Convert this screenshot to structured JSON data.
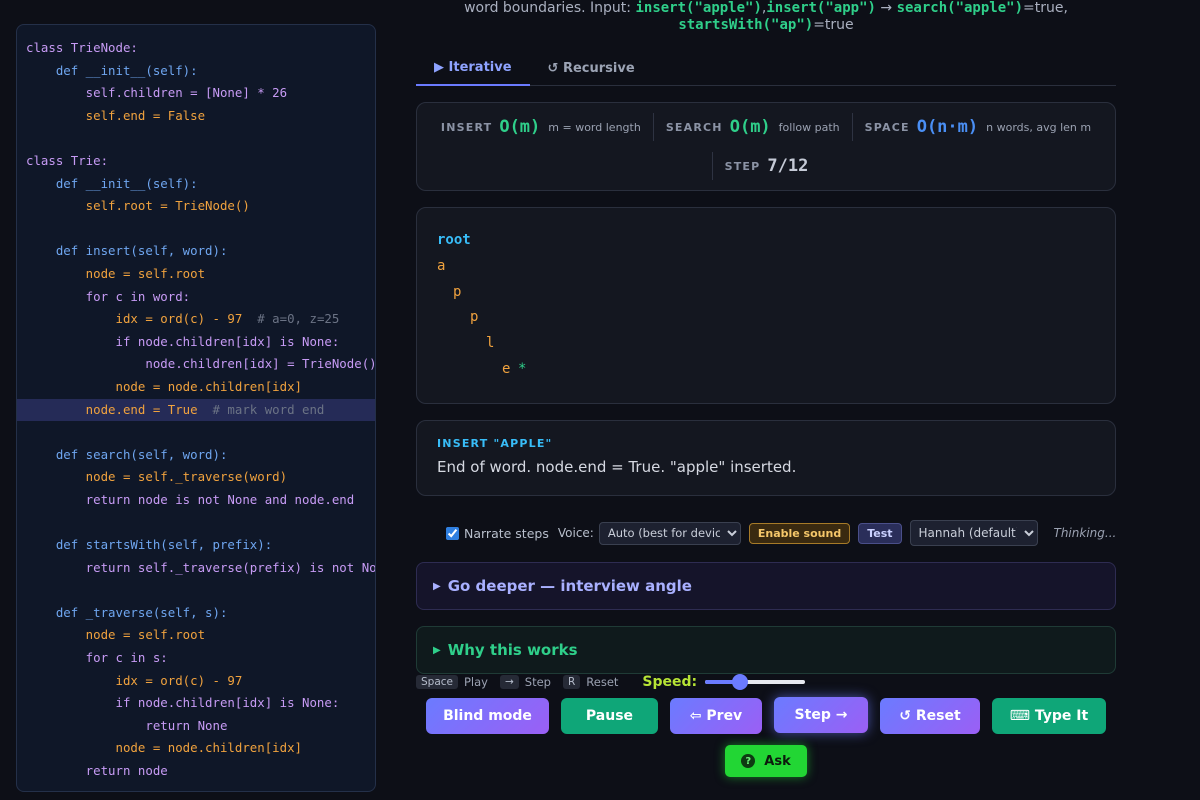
{
  "colors": {
    "accent": "#6b7bff",
    "green": "#2fcf8a",
    "cyan": "#38bdf8",
    "orange": "#f0a23e",
    "lime": "#b6e335"
  },
  "task": {
    "line1_prefix": "word boundaries. Input: ",
    "ins_apple": "insert(\"apple\")",
    "comma": ",",
    "ins_app": "insert(\"app\")",
    "arrow": "→",
    "search_apple": "search(\"apple\")",
    "eq_true_comma": "=true,",
    "starts_ap": "startsWith(\"ap\")",
    "eq_true": "=true"
  },
  "code_lines": [
    {
      "text": "class TrieNode:",
      "color": "purple"
    },
    {
      "text": "    def __init__(self):",
      "color": "blue"
    },
    {
      "text": "        self.children = [None] * 26",
      "color": "purple"
    },
    {
      "text": "        self.end = False",
      "color": "orange"
    },
    {
      "text": "",
      "color": "purple"
    },
    {
      "text": "class Trie:",
      "color": "purple"
    },
    {
      "text": "    def __init__(self):",
      "color": "blue"
    },
    {
      "text": "        self.root = TrieNode()",
      "color": "orange"
    },
    {
      "text": "",
      "color": "purple"
    },
    {
      "text": "    def insert(self, word):",
      "color": "blue"
    },
    {
      "text": "        node = self.root",
      "color": "orange"
    },
    {
      "text": "        for c in word:",
      "color": "purple"
    },
    {
      "text": "            idx = ord(c) - 97",
      "comment": "  # a=0, z=25",
      "color": "orange"
    },
    {
      "text": "            if node.children[idx] is None:",
      "color": "purple"
    },
    {
      "text": "                node.children[idx] = TrieNode()",
      "color": "purple"
    },
    {
      "text": "            node = node.children[idx]",
      "color": "orange"
    },
    {
      "text": "        node.end = True",
      "comment": "  # mark word end",
      "color": "orange",
      "highlight": true
    },
    {
      "text": "",
      "color": "purple"
    },
    {
      "text": "    def search(self, word):",
      "color": "blue"
    },
    {
      "text": "        node = self._traverse(word)",
      "color": "orange"
    },
    {
      "text": "        return node is not None and node.end",
      "color": "purple"
    },
    {
      "text": "",
      "color": "purple"
    },
    {
      "text": "    def startsWith(self, prefix):",
      "color": "blue"
    },
    {
      "text": "        return self._traverse(prefix) is not None",
      "color": "purple"
    },
    {
      "text": "",
      "color": "purple"
    },
    {
      "text": "    def _traverse(self, s):",
      "color": "blue"
    },
    {
      "text": "        node = self.root",
      "color": "orange"
    },
    {
      "text": "        for c in s:",
      "color": "purple"
    },
    {
      "text": "            idx = ord(c) - 97",
      "color": "orange"
    },
    {
      "text": "            if node.children[idx] is None:",
      "color": "purple"
    },
    {
      "text": "                return None",
      "color": "purple"
    },
    {
      "text": "            node = node.children[idx]",
      "color": "orange"
    },
    {
      "text": "        return node",
      "color": "purple"
    }
  ],
  "tabs": [
    {
      "label": "▶ Iterative",
      "active": true
    },
    {
      "label": "↺ Recursive",
      "active": false
    }
  ],
  "complexity": {
    "insert": {
      "label": "INSERT",
      "value": "O(m)",
      "note": "m = word length",
      "color": "#2fcf8a"
    },
    "search": {
      "label": "SEARCH",
      "value": "O(m)",
      "note": "follow path",
      "color": "#2fcf8a"
    },
    "space": {
      "label": "SPACE",
      "value": "O(n·m)",
      "note": "n words, avg len m",
      "color": "#4a8ff5"
    },
    "step": {
      "label": "STEP",
      "value": "7/12"
    }
  },
  "trie": {
    "root": "root",
    "letters": [
      "a",
      "p",
      "p",
      "l",
      "e"
    ],
    "end_marker": "*"
  },
  "status": {
    "title": "INSERT \"APPLE\"",
    "message": "End of word. node.end = True. \"apple\" inserted."
  },
  "narration": {
    "checkbox_label": "Narrate steps",
    "checked": true,
    "voice_label": "Voice:",
    "voice_value": "Auto (best for device)",
    "enable_sound": "Enable sound",
    "test": "Test",
    "voice_name": "Hannah (default)",
    "thinking": "Thinking..."
  },
  "details": {
    "deeper": "Go deeper — interview angle",
    "why": "Why this works"
  },
  "shortcuts": [
    {
      "key": "Space",
      "label": "Play"
    },
    {
      "key": "→",
      "label": "Step"
    },
    {
      "key": "R",
      "label": "Reset"
    }
  ],
  "speed": {
    "label": "Speed:",
    "value": 0.35
  },
  "buttons": {
    "blind": "Blind mode",
    "pause": " Pause",
    "prev": "⇦ Prev",
    "step": "Step →",
    "reset": "↺ Reset",
    "type": "⌨ Type It",
    "ask": "Ask",
    "ask_icon": "?"
  }
}
